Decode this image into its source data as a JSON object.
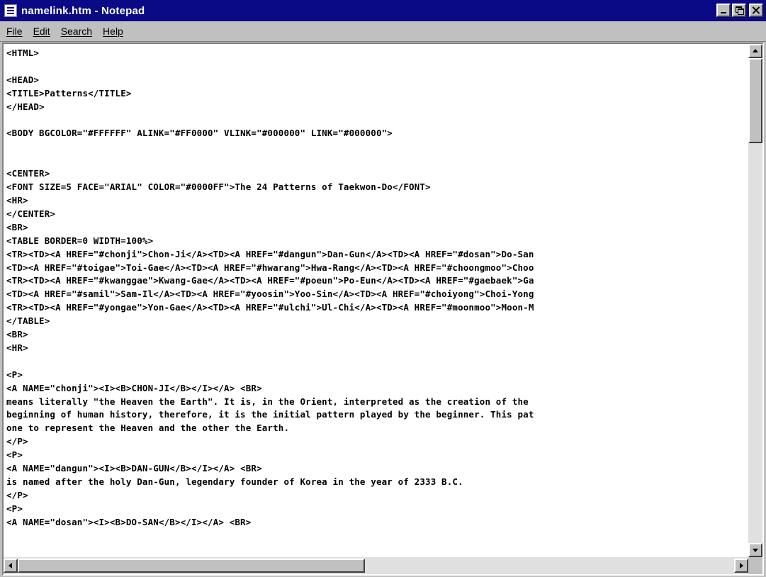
{
  "window": {
    "title": "namelink.htm - Notepad"
  },
  "menu": {
    "items": [
      "File",
      "Edit",
      "Search",
      "Help"
    ]
  },
  "editor": {
    "lines": [
      "<HTML>",
      "",
      "<HEAD>",
      "<TITLE>Patterns</TITLE>",
      "</HEAD>",
      "",
      "<BODY BGCOLOR=\"#FFFFFF\" ALINK=\"#FF0000\" VLINK=\"#000000\" LINK=\"#000000\">",
      "",
      "",
      "<CENTER>",
      "<FONT SIZE=5 FACE=\"ARIAL\" COLOR=\"#0000FF\">The 24 Patterns of Taekwon-Do</FONT>",
      "<HR>",
      "</CENTER>",
      "<BR>",
      "<TABLE BORDER=0 WIDTH=100%>",
      "<TR><TD><A HREF=\"#chonji\">Chon-Ji</A><TD><A HREF=\"#dangun\">Dan-Gun</A><TD><A HREF=\"#dosan\">Do-San",
      "<TD><A HREF=\"#toigae\">Toi-Gae</A><TD><A HREF=\"#hwarang\">Hwa-Rang</A><TD><A HREF=\"#choongmoo\">Choo",
      "<TR><TD><A HREF=\"#kwanggae\">Kwang-Gae</A><TD><A HREF=\"#poeun\">Po-Eun</A><TD><A HREF=\"#gaebaek\">Ga",
      "<TD><A HREF=\"#samil\">Sam-Il</A><TD><A HREF=\"#yoosin\">Yoo-Sin</A><TD><A HREF=\"#choiyong\">Choi-Yong",
      "<TR><TD><A HREF=\"#yongae\">Yon-Gae</A><TD><A HREF=\"#ulchi\">Ul-Chi</A><TD><A HREF=\"#moonmoo\">Moon-M",
      "</TABLE>",
      "<BR>",
      "<HR>",
      "",
      "<P>",
      "<A NAME=\"chonji\"><I><B>CHON-JI</B></I></A> <BR>",
      "means literally \"the Heaven the Earth\". It is, in the Orient, interpreted as the creation of the",
      "beginning of human history, therefore, it is the initial pattern played by the beginner. This pat",
      "one to represent the Heaven and the other the Earth.",
      "</P>",
      "<P>",
      "<A NAME=\"dangun\"><I><B>DAN-GUN</B></I></A> <BR>",
      "is named after the holy Dan-Gun, legendary founder of Korea in the year of 2333 B.C.",
      "</P>",
      "<P>",
      "<A NAME=\"dosan\"><I><B>DO-SAN</B></I></A> <BR>"
    ]
  }
}
